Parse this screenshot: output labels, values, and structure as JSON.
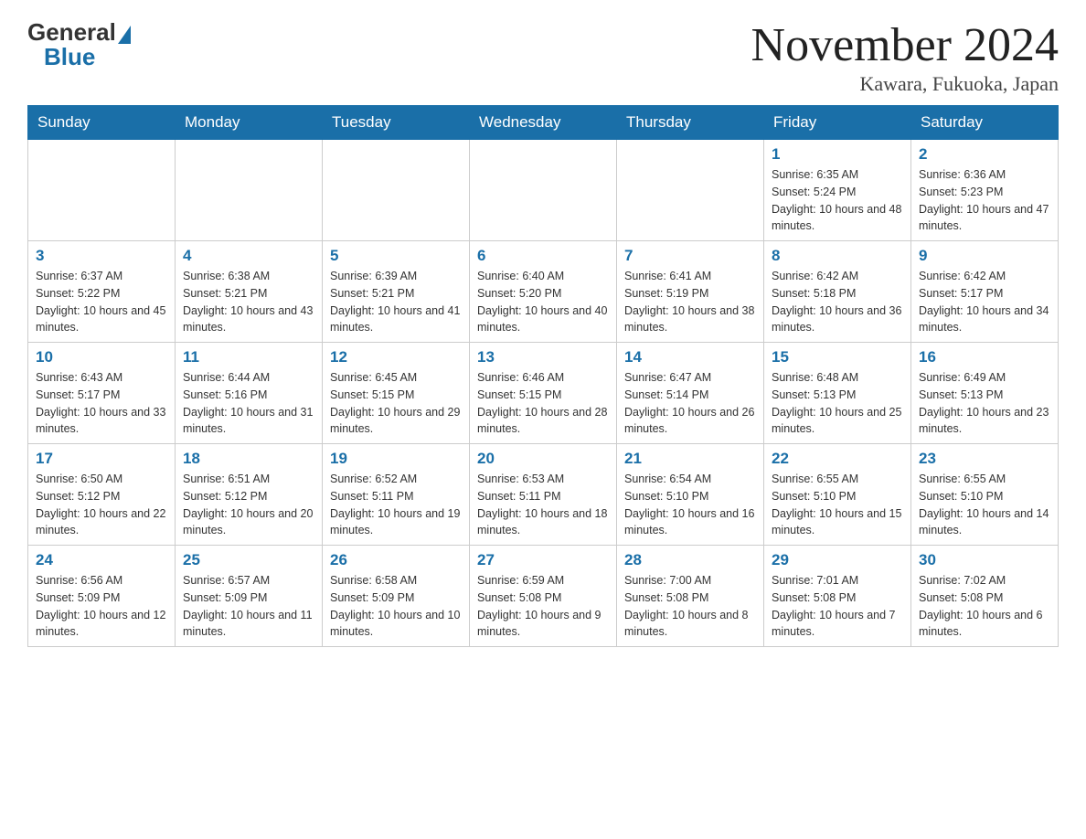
{
  "header": {
    "logo_general": "General",
    "logo_blue": "Blue",
    "month_title": "November 2024",
    "location": "Kawara, Fukuoka, Japan"
  },
  "weekdays": [
    "Sunday",
    "Monday",
    "Tuesday",
    "Wednesday",
    "Thursday",
    "Friday",
    "Saturday"
  ],
  "rows": [
    [
      {
        "day": "",
        "sunrise": "",
        "sunset": "",
        "daylight": ""
      },
      {
        "day": "",
        "sunrise": "",
        "sunset": "",
        "daylight": ""
      },
      {
        "day": "",
        "sunrise": "",
        "sunset": "",
        "daylight": ""
      },
      {
        "day": "",
        "sunrise": "",
        "sunset": "",
        "daylight": ""
      },
      {
        "day": "",
        "sunrise": "",
        "sunset": "",
        "daylight": ""
      },
      {
        "day": "1",
        "sunrise": "Sunrise: 6:35 AM",
        "sunset": "Sunset: 5:24 PM",
        "daylight": "Daylight: 10 hours and 48 minutes."
      },
      {
        "day": "2",
        "sunrise": "Sunrise: 6:36 AM",
        "sunset": "Sunset: 5:23 PM",
        "daylight": "Daylight: 10 hours and 47 minutes."
      }
    ],
    [
      {
        "day": "3",
        "sunrise": "Sunrise: 6:37 AM",
        "sunset": "Sunset: 5:22 PM",
        "daylight": "Daylight: 10 hours and 45 minutes."
      },
      {
        "day": "4",
        "sunrise": "Sunrise: 6:38 AM",
        "sunset": "Sunset: 5:21 PM",
        "daylight": "Daylight: 10 hours and 43 minutes."
      },
      {
        "day": "5",
        "sunrise": "Sunrise: 6:39 AM",
        "sunset": "Sunset: 5:21 PM",
        "daylight": "Daylight: 10 hours and 41 minutes."
      },
      {
        "day": "6",
        "sunrise": "Sunrise: 6:40 AM",
        "sunset": "Sunset: 5:20 PM",
        "daylight": "Daylight: 10 hours and 40 minutes."
      },
      {
        "day": "7",
        "sunrise": "Sunrise: 6:41 AM",
        "sunset": "Sunset: 5:19 PM",
        "daylight": "Daylight: 10 hours and 38 minutes."
      },
      {
        "day": "8",
        "sunrise": "Sunrise: 6:42 AM",
        "sunset": "Sunset: 5:18 PM",
        "daylight": "Daylight: 10 hours and 36 minutes."
      },
      {
        "day": "9",
        "sunrise": "Sunrise: 6:42 AM",
        "sunset": "Sunset: 5:17 PM",
        "daylight": "Daylight: 10 hours and 34 minutes."
      }
    ],
    [
      {
        "day": "10",
        "sunrise": "Sunrise: 6:43 AM",
        "sunset": "Sunset: 5:17 PM",
        "daylight": "Daylight: 10 hours and 33 minutes."
      },
      {
        "day": "11",
        "sunrise": "Sunrise: 6:44 AM",
        "sunset": "Sunset: 5:16 PM",
        "daylight": "Daylight: 10 hours and 31 minutes."
      },
      {
        "day": "12",
        "sunrise": "Sunrise: 6:45 AM",
        "sunset": "Sunset: 5:15 PM",
        "daylight": "Daylight: 10 hours and 29 minutes."
      },
      {
        "day": "13",
        "sunrise": "Sunrise: 6:46 AM",
        "sunset": "Sunset: 5:15 PM",
        "daylight": "Daylight: 10 hours and 28 minutes."
      },
      {
        "day": "14",
        "sunrise": "Sunrise: 6:47 AM",
        "sunset": "Sunset: 5:14 PM",
        "daylight": "Daylight: 10 hours and 26 minutes."
      },
      {
        "day": "15",
        "sunrise": "Sunrise: 6:48 AM",
        "sunset": "Sunset: 5:13 PM",
        "daylight": "Daylight: 10 hours and 25 minutes."
      },
      {
        "day": "16",
        "sunrise": "Sunrise: 6:49 AM",
        "sunset": "Sunset: 5:13 PM",
        "daylight": "Daylight: 10 hours and 23 minutes."
      }
    ],
    [
      {
        "day": "17",
        "sunrise": "Sunrise: 6:50 AM",
        "sunset": "Sunset: 5:12 PM",
        "daylight": "Daylight: 10 hours and 22 minutes."
      },
      {
        "day": "18",
        "sunrise": "Sunrise: 6:51 AM",
        "sunset": "Sunset: 5:12 PM",
        "daylight": "Daylight: 10 hours and 20 minutes."
      },
      {
        "day": "19",
        "sunrise": "Sunrise: 6:52 AM",
        "sunset": "Sunset: 5:11 PM",
        "daylight": "Daylight: 10 hours and 19 minutes."
      },
      {
        "day": "20",
        "sunrise": "Sunrise: 6:53 AM",
        "sunset": "Sunset: 5:11 PM",
        "daylight": "Daylight: 10 hours and 18 minutes."
      },
      {
        "day": "21",
        "sunrise": "Sunrise: 6:54 AM",
        "sunset": "Sunset: 5:10 PM",
        "daylight": "Daylight: 10 hours and 16 minutes."
      },
      {
        "day": "22",
        "sunrise": "Sunrise: 6:55 AM",
        "sunset": "Sunset: 5:10 PM",
        "daylight": "Daylight: 10 hours and 15 minutes."
      },
      {
        "day": "23",
        "sunrise": "Sunrise: 6:55 AM",
        "sunset": "Sunset: 5:10 PM",
        "daylight": "Daylight: 10 hours and 14 minutes."
      }
    ],
    [
      {
        "day": "24",
        "sunrise": "Sunrise: 6:56 AM",
        "sunset": "Sunset: 5:09 PM",
        "daylight": "Daylight: 10 hours and 12 minutes."
      },
      {
        "day": "25",
        "sunrise": "Sunrise: 6:57 AM",
        "sunset": "Sunset: 5:09 PM",
        "daylight": "Daylight: 10 hours and 11 minutes."
      },
      {
        "day": "26",
        "sunrise": "Sunrise: 6:58 AM",
        "sunset": "Sunset: 5:09 PM",
        "daylight": "Daylight: 10 hours and 10 minutes."
      },
      {
        "day": "27",
        "sunrise": "Sunrise: 6:59 AM",
        "sunset": "Sunset: 5:08 PM",
        "daylight": "Daylight: 10 hours and 9 minutes."
      },
      {
        "day": "28",
        "sunrise": "Sunrise: 7:00 AM",
        "sunset": "Sunset: 5:08 PM",
        "daylight": "Daylight: 10 hours and 8 minutes."
      },
      {
        "day": "29",
        "sunrise": "Sunrise: 7:01 AM",
        "sunset": "Sunset: 5:08 PM",
        "daylight": "Daylight: 10 hours and 7 minutes."
      },
      {
        "day": "30",
        "sunrise": "Sunrise: 7:02 AM",
        "sunset": "Sunset: 5:08 PM",
        "daylight": "Daylight: 10 hours and 6 minutes."
      }
    ]
  ]
}
